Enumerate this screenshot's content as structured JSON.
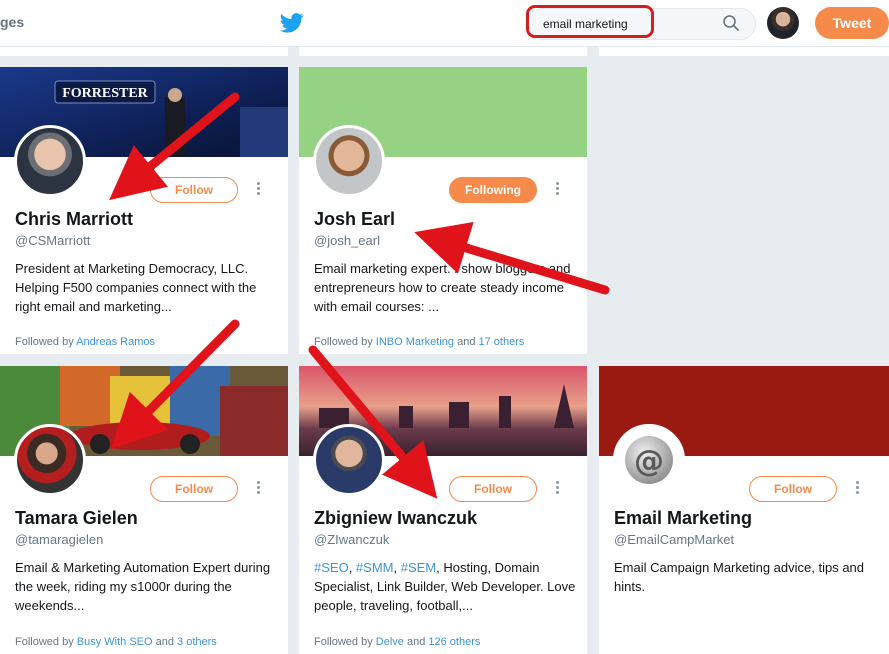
{
  "topbar": {
    "nav_partial": "ges",
    "search_value": "email marketing",
    "tweet_label": "Tweet",
    "accent_color": "#f58a4b"
  },
  "cards": [
    {
      "name": "Chris Marriott",
      "handle": "@CSMarriott",
      "button": "Follow",
      "bio": "President at Marketing Democracy, LLC. Helping F500 companies connect with the right email and marketing...",
      "followed_prefix": "Followed by",
      "followed_names": "Andreas Ramos",
      "followed_and": "",
      "followed_others": "",
      "banner_text": "FORRESTER"
    },
    {
      "name": "Josh Earl",
      "handle": "@josh_earl",
      "button": "Following",
      "bio": "Email marketing expert. I show bloggers and entrepreneurs how to create steady income with email courses: ...",
      "followed_prefix": "Followed by",
      "followed_names": "INBO Marketing",
      "followed_and": "and",
      "followed_others": "17 others"
    },
    {
      "name": "Tamara Gielen",
      "handle": "@tamaragielen",
      "button": "Follow",
      "bio": "Email & Marketing Automation Expert during the week, riding my s1000r during the weekends...",
      "followed_prefix": "Followed by",
      "followed_names": "Busy With SEO",
      "followed_and": "and",
      "followed_others": "3 others"
    },
    {
      "name": "Zbigniew Iwanczuk",
      "handle": "@ZIwanczuk",
      "button": "Follow",
      "bio_tags": [
        "#SEO",
        "#SMM",
        "#SEM"
      ],
      "bio_sep": ", ",
      "bio": ", Hosting, Domain Specialist, Link Builder, Web Developer. Love people, traveling, football,...",
      "followed_prefix": "Followed by",
      "followed_names": "Delve",
      "followed_and": "and",
      "followed_others": "126 others"
    },
    {
      "name": "Email Marketing",
      "handle": "@EmailCampMarket",
      "button": "Follow",
      "bio": "Email Campaign Marketing advice, tips and hints.",
      "followed_prefix": "",
      "followed_names": "",
      "followed_and": "",
      "followed_others": ""
    }
  ],
  "icons": {
    "logo": "twitter-bird-icon",
    "search": "search-icon",
    "more": "more-vertical-icon"
  }
}
